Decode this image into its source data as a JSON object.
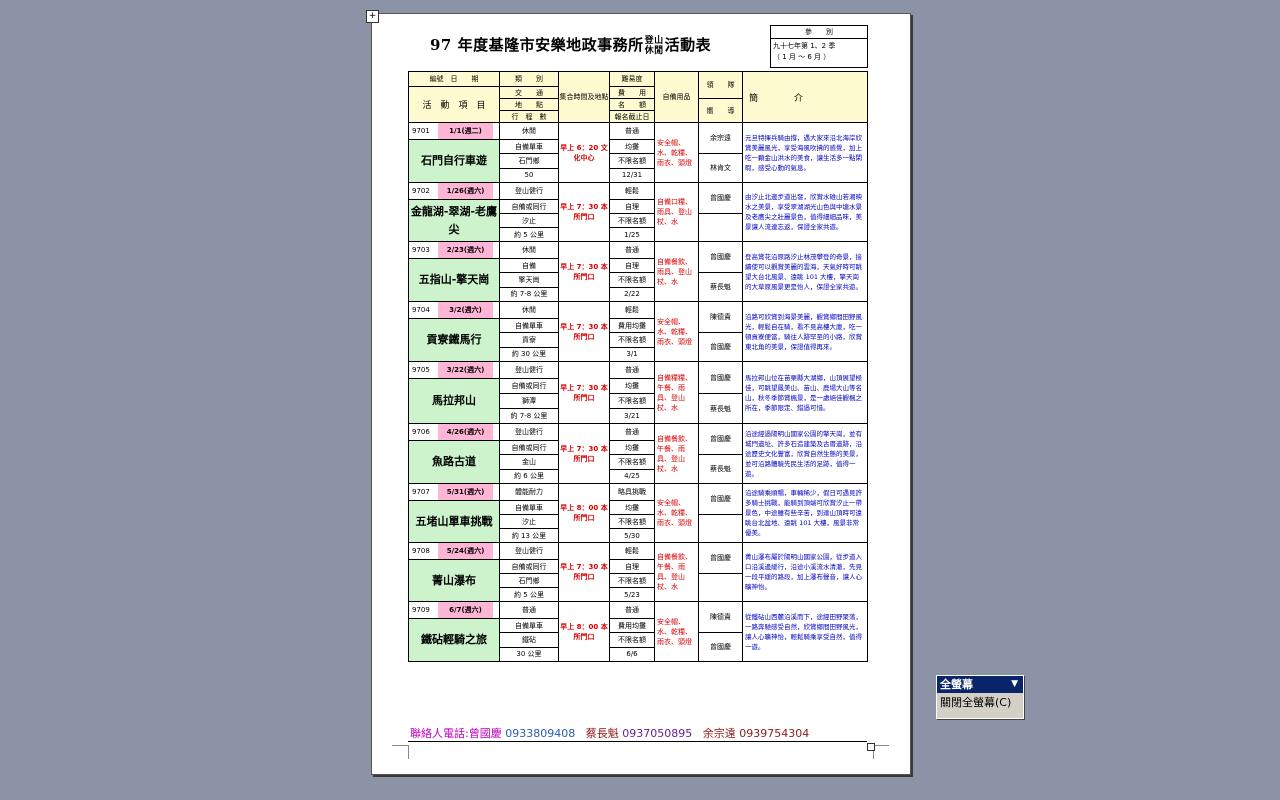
{
  "title": {
    "pre": "97 年度基隆市安樂地政事務所",
    "stack_top": "登山",
    "stack_bottom": "休閒",
    "post": "活動表"
  },
  "ref": {
    "label": "參　　別",
    "line1": "九十七年第 1、2 季",
    "line2": "（ 1 月 ～ 6 月 ）"
  },
  "headers": {
    "code_label": "編號",
    "date_label": "日　　期",
    "item_label": "活　動　項　目",
    "cat_label": "類　　別",
    "transport_label": "交　　通",
    "location_label": "地　　點",
    "plan_label": "行　程　數",
    "meet_label": "集合時間及地點",
    "difficulty_label": "難易度",
    "fee_label": "費　　用",
    "quota_label": "名　　額",
    "deadline_label": "報名截止日",
    "equip_label": "自備用品",
    "leader_label": "領　　隊",
    "guide_label": "嚮　　導",
    "desc_label": "簡　　　　介"
  },
  "rows": [
    {
      "code": "9701",
      "date": "1/1(週二)",
      "name": "石門自行車遊",
      "cat": "休閒",
      "transport": "自備單車",
      "location": "石門鄉",
      "plan": "50",
      "meet": "早上 6：20 文化中心",
      "difficulty": "普通",
      "fee": "均攤",
      "quota": "不限名額",
      "deadline": "12/31",
      "equip": "安全帽、水、乾糧、雨衣、頭燈",
      "leader": "余宗遠",
      "guide": "林肯文",
      "desc": "元旦特揮兵騎由撐，遇大家來沿北海岸欣賞美麗風光，享受海風吹拂的感覺，加上吃一顆金山洪水的美食，讓生活多一點閑暇，感受心動的氣息。"
    },
    {
      "code": "9702",
      "date": "1/26(週六)",
      "name": "金龍湖-翠湖-老鷹尖",
      "cat": "登山健行",
      "transport": "自備或同行",
      "location": "汐止",
      "plan": "約 5 公里",
      "meet": "早上 7：30 本所門口",
      "difficulty": "輕鬆",
      "fee": "自理",
      "quota": "不限名額",
      "deadline": "1/25",
      "equip": "自備口糧、雨具、登山杖、水",
      "leader": "曾國慶",
      "guide": "",
      "desc": "由汐止北邊步道出發，欣賞水碓山若潮映水之美景，享受翠湖湖光山色與中塘水景及老鷹尖之壯麗景色，值得細細品味，美景讓人流連忘返，保證全家共遊。"
    },
    {
      "code": "9703",
      "date": "2/23(週六)",
      "name": "五指山-擎天崗",
      "cat": "休閒",
      "transport": "自備",
      "location": "擎天崗",
      "plan": "約 7-8 公里",
      "meet": "早上 7：30 本所門口",
      "difficulty": "普通",
      "fee": "自理",
      "quota": "不限名額",
      "deadline": "2/22",
      "equip": "自備餐飲、雨具、登山杖、水",
      "leader": "曾國慶",
      "guide": "蔡長魁",
      "desc": "登高賞花沿原路汐止林茂攀登的奇景，接續使可以觀賞美麗的雲海，天氣好時可眺望大台北風景、遠眺 101 大樓，擎天崗的大草原風景更是怡人，保證全家共遊。"
    },
    {
      "code": "9704",
      "date": "3/2(週六)",
      "name": "貢寮鐵馬行",
      "cat": "休閒",
      "transport": "自備單車",
      "location": "貢寮",
      "plan": "約 30 公里",
      "meet": "早上 7：30 本所門口",
      "difficulty": "輕鬆",
      "fee": "費用均攤",
      "quota": "不限名額",
      "deadline": "3/1",
      "equip": "安全帽、水、乾糧、雨衣、頭燈",
      "leader": "陳德貴",
      "guide": "曾國慶",
      "desc": "沿路可欣賞到海景美麗，觀賞鄉間田野風光，輕鬆自在騎，看不見高樓大廈，吃一頓貢寮便當，騎往人跡罕至的小路，欣賞東北角的美景，保證值得再來。"
    },
    {
      "code": "9705",
      "date": "3/22(週六)",
      "name": "馬拉邦山",
      "cat": "登山健行",
      "transport": "自備或同行",
      "location": "獅潭",
      "plan": "約 7-8 公里",
      "meet": "早上 7：30 本所門口",
      "difficulty": "普通",
      "fee": "均攤",
      "quota": "不限名額",
      "deadline": "3/21",
      "equip": "自備糧糧、午餐、雨具、登山杖、水",
      "leader": "曾國慶",
      "guide": "蔡長魁",
      "desc": "馬拉邦山位在苗栗縣大湖鄉，山頂展望極佳，可眺望鳳美山、苗山、鹿場大山等名山，秋冬季節賞楓景，是一處絕佳觀楓之所在，季節限定、錯過可惜。"
    },
    {
      "code": "9706",
      "date": "4/26(週六)",
      "name": "魚路古道",
      "cat": "登山健行",
      "transport": "自備或同行",
      "location": "金山",
      "plan": "約 6 公里",
      "meet": "早上 7：30 本所門口",
      "difficulty": "普通",
      "fee": "均攤",
      "quota": "不限名額",
      "deadline": "4/25",
      "equip": "自備餐飲、午餐、雨具、登山杖、水",
      "leader": "曾國慶",
      "guide": "蔡長魁",
      "desc": "沿途經過陽明山國家公園的擎天崗，並有城門遺址、許多石造建築及古厝遺跡，沿途歷史文化豐富，欣賞自然生態的美景，並可沿路體驗先民生活的足跡，值得一遊。"
    },
    {
      "code": "9707",
      "date": "5/31(週六)",
      "name": "五堵山單車挑戰",
      "cat": "體能耐力",
      "transport": "自備單車",
      "location": "汐止",
      "plan": "約 13 公里",
      "meet": "早上 8：00 本所門口",
      "difficulty": "略具挑戰",
      "fee": "均攤",
      "quota": "不限名額",
      "deadline": "5/30",
      "equip": "安全帽、水、乾糧、雨衣、頭燈",
      "leader": "曾國慶",
      "guide": "",
      "desc": "沿途騎乘順暢，車輛稀少，假日可遇見許多騎士挑戰，能騎到頂端可欣賞汐止一帶景色，中途雖有些辛苦，到達山頂時可遠眺台北盆地、遠眺 101 大樓，風景非常優美。"
    },
    {
      "code": "9708",
      "date": "5/24(週六)",
      "name": "菁山瀑布",
      "cat": "登山健行",
      "transport": "自備或同行",
      "location": "石門鄉",
      "plan": "約 5 公里",
      "meet": "早上 7：30 本所門口",
      "difficulty": "輕鬆",
      "fee": "自理",
      "quota": "不限名額",
      "deadline": "5/23",
      "equip": "自備餐飲、午餐、雨具、登山杖、水",
      "leader": "曾國慶",
      "guide": "",
      "desc": "菁山瀑布屬於陽明山國家公園，從步道入口沿溪邊緩行，沿途小溪流水清澈，先見一段平緩的路段，加上瀑布聲音，讓人心曠神怡。"
    },
    {
      "code": "9709",
      "date": "6/7(週六)",
      "name": "鐵砧輕騎之旅",
      "cat": "普通",
      "transport": "自備單車",
      "location": "鐵砧",
      "plan": "30 公里",
      "meet": "早上 8：00 本所門口",
      "difficulty": "普通",
      "fee": "費用均攤",
      "quota": "不限名額",
      "deadline": "6/6",
      "equip": "安全帽、水、乾糧、雨衣、頭燈",
      "leader": "陳德貴",
      "guide": "曾國慶",
      "desc": "從鐵砧山西麓沿溪而下，途經田野聚落，一路奔馳感受自然，欣賞鄉間田野風光，讓人心曠神怡，輕鬆騎乘享受自然，值得一遊。"
    }
  ],
  "footer": {
    "label": "聯絡人電話:",
    "p1_name": "曾國慶",
    "p1_phone": "0933809408",
    "p2_name": "蔡長魁",
    "p2_phone": "0937050895",
    "p3_name": "余宗遠",
    "p3_phone": "0939754304"
  },
  "fullscreen_toolbar": {
    "title": "全螢幕",
    "button": "關閉全螢幕(C)"
  }
}
